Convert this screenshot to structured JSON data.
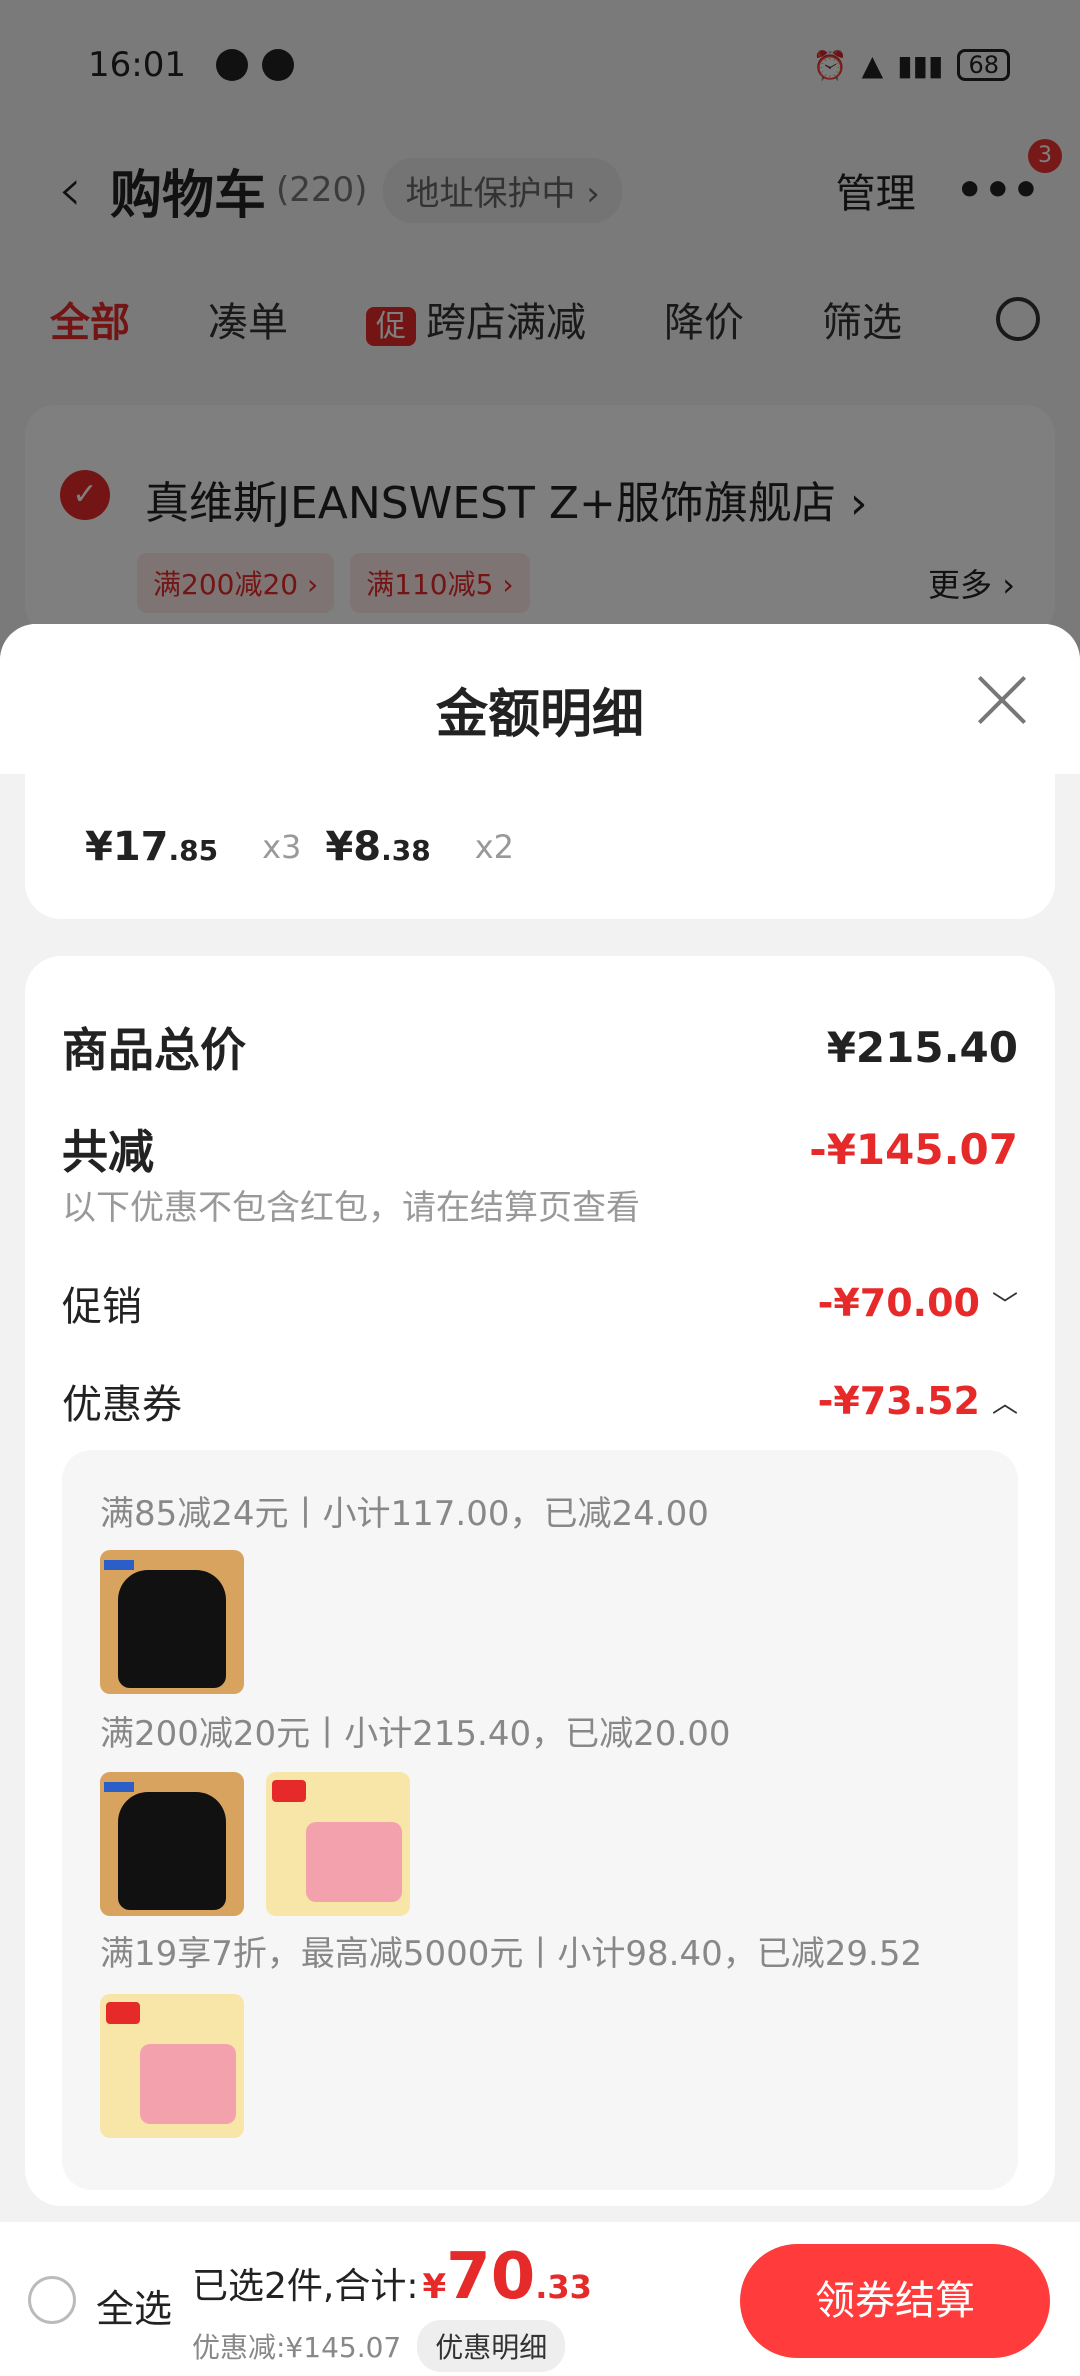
{
  "status": {
    "time": "16:01",
    "battery": "68"
  },
  "nav": {
    "back": "‹",
    "title": "购物车",
    "count": "(220)",
    "address": "地址保护中 ›",
    "manage": "管理",
    "more": "•••",
    "badge": "3"
  },
  "tabs": [
    {
      "label": "全部",
      "active": true
    },
    {
      "label": "凑单"
    },
    {
      "label": "跨店满减",
      "tag": "促"
    },
    {
      "label": "降价"
    },
    {
      "label": "筛选"
    }
  ],
  "store": {
    "name": "真维斯JEANSWEST Z+服饰旗舰店 ›",
    "coupons": [
      "满200减20 ›",
      "满110减5 ›"
    ],
    "more": "更多 ›"
  },
  "sheet": {
    "title": "金额明细",
    "items": [
      {
        "price_int": "¥17",
        "price_dec": ".85",
        "qty": "x3"
      },
      {
        "price_int": "¥8",
        "price_dec": ".38",
        "qty": "x2"
      }
    ],
    "total_label": "商品总价",
    "total_value": "¥215.40",
    "discount_label": "共减",
    "discount_value": "-¥145.07",
    "discount_note": "以下优惠不包含红包，请在结算页查看",
    "promo_label": "促销",
    "promo_value": "-¥70.00",
    "promo_chevron": "﹀",
    "coupon_label": "优惠券",
    "coupon_value": "-¥73.52",
    "coupon_chevron": "︿",
    "coupon_groups": [
      {
        "title": "满85减24元丨小计117.00，已减24.00",
        "thumbs": [
          "sweater"
        ]
      },
      {
        "title": "满200减20元丨小计215.40，已减20.00",
        "thumbs": [
          "sweater",
          "detergent"
        ]
      },
      {
        "title": "满19享7折，最高减5000元丨小计98.40，已减29.52",
        "thumbs": [
          "detergent"
        ]
      }
    ]
  },
  "bottom": {
    "select_all": "全选",
    "selected_text": "已选2件,合计:",
    "currency": "¥",
    "total_int": "70",
    "total_dec": ".33",
    "discount_text": "优惠减:¥145.07",
    "detail_link": "优惠明细",
    "checkout": "领券结算"
  },
  "colors": {
    "accent": "#e62a2a",
    "checkout": "#ff3b3b"
  }
}
